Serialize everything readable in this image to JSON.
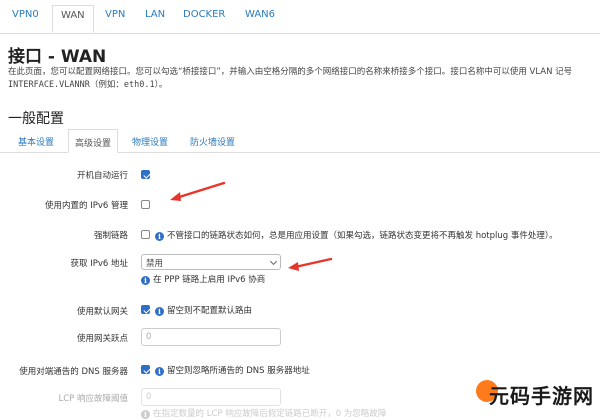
{
  "top_tabs": [
    "VPN0",
    "WAN",
    "VPN",
    "LAN",
    "DOCKER",
    "WAN6"
  ],
  "active_top_tab": "WAN",
  "page_title": "接口 - WAN",
  "description_line1": "在此页面，您可以配置网络接口。您可以勾选“桥接接口”，并输入由空格分隔的多个网络接口的名称来桥接多个接口。接口名称中可以使用 VLAN 记号",
  "description_line2": "INTERFACE.VLANNR（例如：eth0.1）。",
  "section_title": "一般配置",
  "sub_tabs": [
    "基本设置",
    "高级设置",
    "物理设置",
    "防火墙设置"
  ],
  "active_sub_tab": "高级设置",
  "fields": {
    "autostart": {
      "label": "开机自动运行",
      "checked": true
    },
    "builtin_ipv6": {
      "label": "使用内置的 IPv6 管理",
      "checked": false
    },
    "force_link": {
      "label": "强制链路",
      "checked": false,
      "hint": "不管接口的链路状态如何，总是用应用设置（如果勾选，链路状态变更将不再触发 hotplug 事件处理）。"
    },
    "ipv6_get": {
      "label": "获取 IPv6 地址",
      "value": "禁用",
      "hint": "在 PPP 链路上启用 IPv6 协商"
    },
    "default_gw": {
      "label": "使用默认网关",
      "checked": true,
      "hint": "留空则不配置默认路由"
    },
    "gw_metric": {
      "label": "使用网关跃点",
      "placeholder": "0"
    },
    "peer_dns": {
      "label": "使用对端通告的 DNS 服务器",
      "checked": true,
      "hint": "留空则忽略所通告的 DNS 服务器地址"
    },
    "lcp_threshold": {
      "label": "LCP 响应故障阈值",
      "placeholder": "0",
      "hint": "在指定数量的 LCP 响应故障后假定链路已断开，0 为忽略故障"
    }
  },
  "watermark": {
    "text": "元码手游网"
  },
  "colors": {
    "link": "#2b7bbf",
    "checkbox": "#2f6fc8",
    "arrow": "#e8342a"
  }
}
